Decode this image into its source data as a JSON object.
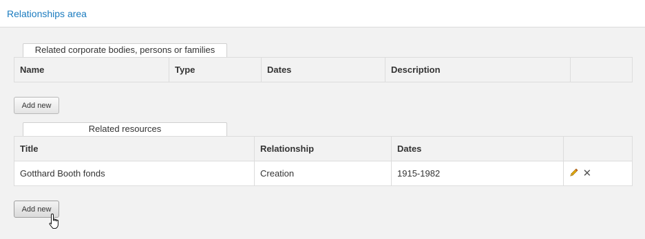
{
  "header": {
    "title": "Relationships area"
  },
  "actors": {
    "tab_label": "Related corporate bodies, persons or families",
    "columns": [
      "Name",
      "Type",
      "Dates",
      "Description",
      ""
    ],
    "rows": [],
    "add_label": "Add new"
  },
  "resources": {
    "tab_label": "Related resources",
    "columns": [
      "Title",
      "Relationship",
      "Dates",
      ""
    ],
    "rows": [
      {
        "title": "Gotthard Booth fonds",
        "relationship": "Creation",
        "dates": "1915-1982"
      }
    ],
    "add_label": "Add new"
  },
  "icons": {
    "edit": "pencil-icon",
    "delete": "close-icon",
    "cursor": "hand-pointer-icon"
  }
}
